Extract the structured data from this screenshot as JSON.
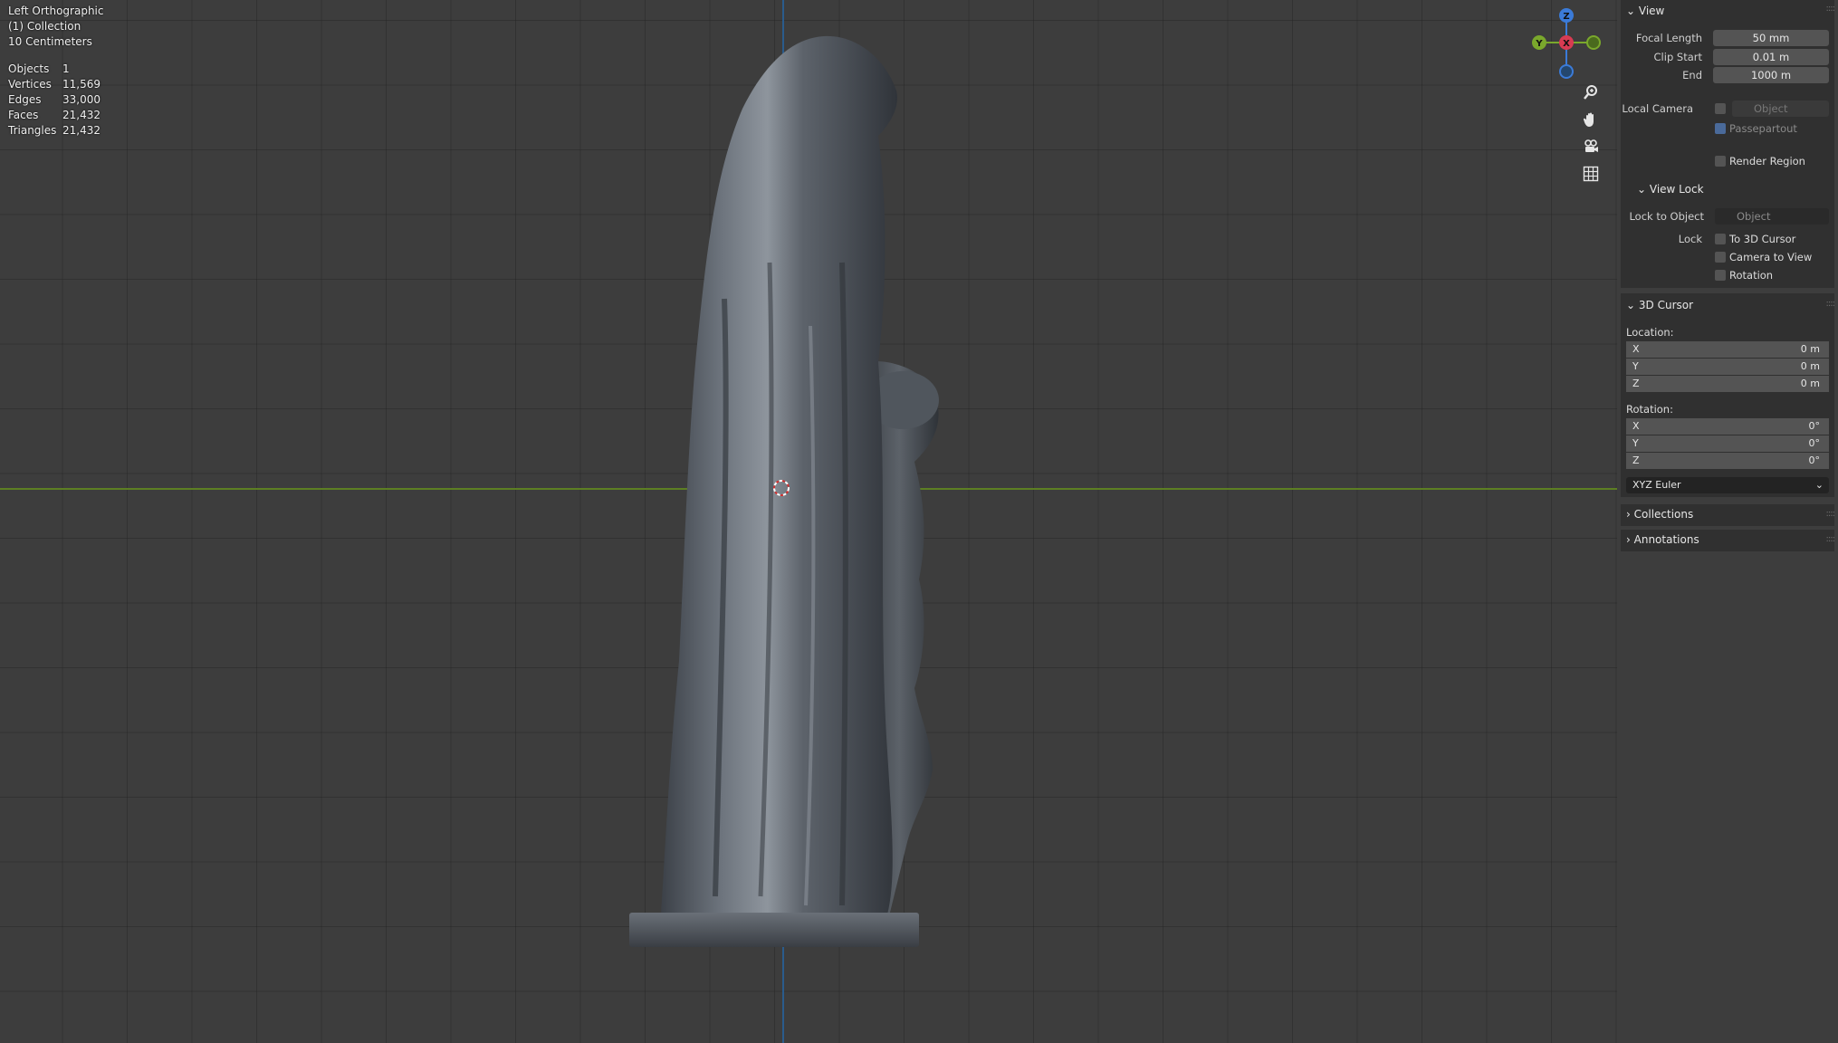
{
  "viewport": {
    "view_name": "Left Orthographic",
    "collection": "(1) Collection",
    "scale": "10 Centimeters",
    "stats": [
      {
        "label": "Objects",
        "value": "1"
      },
      {
        "label": "Vertices",
        "value": "11,569"
      },
      {
        "label": "Edges",
        "value": "33,000"
      },
      {
        "label": "Faces",
        "value": "21,432"
      },
      {
        "label": "Triangles",
        "value": "21,432"
      }
    ],
    "gizmo": {
      "z": "Z",
      "y": "Y",
      "x": "X"
    },
    "nav_icons": [
      "zoom-icon",
      "pan-hand-icon",
      "camera-view-icon",
      "grid-ortho-icon"
    ]
  },
  "panel": {
    "view": {
      "title": "View",
      "focal_length_label": "Focal Length",
      "focal_length": "50 mm",
      "clip_start_label": "Clip Start",
      "clip_start": "0.01 m",
      "end_label": "End",
      "end": "1000 m",
      "local_camera_label": "Local Camera",
      "local_camera_placeholder": "Object",
      "passepartout_label": "Passepartout",
      "render_region_label": "Render Region"
    },
    "view_lock": {
      "title": "View Lock",
      "lock_to_object_label": "Lock to Object",
      "lock_to_object_placeholder": "Object",
      "lock_label": "Lock",
      "to_3d_cursor": "To 3D Cursor",
      "camera_to_view": "Camera to View",
      "rotation": "Rotation"
    },
    "cursor": {
      "title": "3D Cursor",
      "location_label": "Location:",
      "location": [
        {
          "axis": "X",
          "value": "0 m"
        },
        {
          "axis": "Y",
          "value": "0 m"
        },
        {
          "axis": "Z",
          "value": "0 m"
        }
      ],
      "rotation_label": "Rotation:",
      "rotation": [
        {
          "axis": "X",
          "value": "0°"
        },
        {
          "axis": "Y",
          "value": "0°"
        },
        {
          "axis": "Z",
          "value": "0°"
        }
      ],
      "rotation_mode": "XYZ Euler"
    },
    "collections": {
      "title": "Collections"
    },
    "annotations": {
      "title": "Annotations"
    }
  }
}
